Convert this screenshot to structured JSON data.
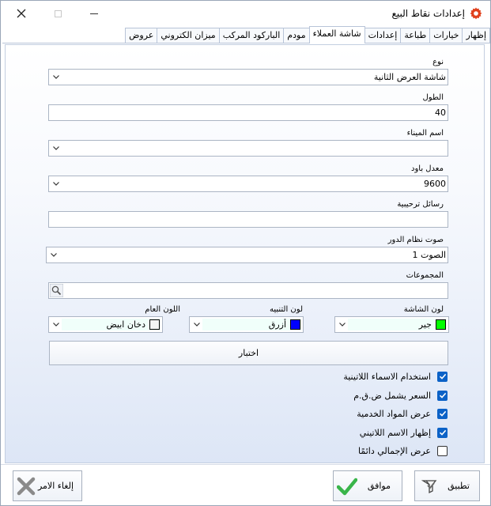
{
  "window": {
    "title": "إعدادات نقاط البيع"
  },
  "tabs": [
    {
      "label": "إظهار"
    },
    {
      "label": "خيارات"
    },
    {
      "label": "طباعة"
    },
    {
      "label": "إعدادات"
    },
    {
      "label": "شاشة العملاء"
    },
    {
      "label": "مودم"
    },
    {
      "label": "الباركود المركب"
    },
    {
      "label": "ميزان الكتروني"
    },
    {
      "label": "عروض"
    }
  ],
  "form": {
    "type": {
      "label": "نوع",
      "value": "شاشة العرض الثانية"
    },
    "length": {
      "label": "الطول",
      "value": "40"
    },
    "port_name": {
      "label": "اسم الميناء",
      "value": ""
    },
    "baud_rate": {
      "label": "معدل باود",
      "value": "9600"
    },
    "welcome_messages": {
      "label": "رسائل ترحيبية",
      "value": ""
    },
    "queue_sound": {
      "label": "صوت نظام الدور",
      "value": "الصوت 1"
    },
    "groups": {
      "label": "المجموعات",
      "value": ""
    },
    "screen_color": {
      "label": "لون الشاشة",
      "value": "جير",
      "swatch": "#00ff00"
    },
    "alert_color": {
      "label": "لون التنبيه",
      "value": "أزرق",
      "swatch": "#0000ff"
    },
    "general_color": {
      "label": "اللون العام",
      "value": "دخان ابيض",
      "swatch": "#f5f5f5"
    },
    "test_label": "اختبار"
  },
  "checkboxes": [
    {
      "label": "استخدام الاسماء اللاتينية",
      "checked": true
    },
    {
      "label": "السعر يشمل ض.ق.م",
      "checked": true
    },
    {
      "label": "عرض المواد الخدمية",
      "checked": true
    },
    {
      "label": "إظهار الاسم اللاتيني",
      "checked": true
    },
    {
      "label": "عرض الإجمالي دائمًا",
      "checked": false
    }
  ],
  "buttons": {
    "apply": "تطبيق",
    "ok": "موافق",
    "cancel": "إلغاء الامر"
  },
  "colors": {
    "accent": "#0c62c7",
    "gear": "#e0401c",
    "ok_check": "#39b54a",
    "cancel_x": "#8a8a8a"
  }
}
